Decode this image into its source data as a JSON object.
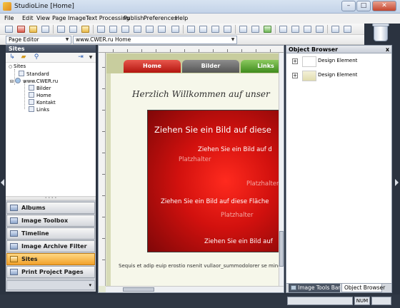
{
  "window": {
    "title": "StudioLine [Home]",
    "minimize": "–",
    "maximize": "□",
    "close": "✕"
  },
  "menu": [
    "File",
    "Edit",
    "View",
    "Page",
    "Image",
    "Text Processing",
    "Publish",
    "Preferences",
    "Help"
  ],
  "toolbar": {
    "mode_select": "Page Editor",
    "page_select": "www.CWER.ru  Home"
  },
  "sites_panel": {
    "title": "Sites",
    "tree": [
      "Sites",
      "Standard",
      "www.CWER.ru",
      "Bilder",
      "Home",
      "Kontakt",
      "Links"
    ]
  },
  "nav": {
    "items": [
      "Albums",
      "Image Toolbox",
      "Timeline",
      "Image Archive Filter",
      "Sites",
      "Print Project Pages"
    ],
    "active": "Sites"
  },
  "editor": {
    "tabs": [
      "Home",
      "Bilder",
      "Links"
    ],
    "headline": "Herzlich Willkommen auf unser",
    "hero_lines": [
      "Ziehen Sie ein Bild auf diese",
      "Ziehen Sie ein Bild auf d",
      "Platzhalter",
      "Platzhalter",
      "Ziehen Sie ein Bild auf diese Fläche",
      "Platzhalter",
      "Ziehen Sie ein Bild auf"
    ],
    "footer": "Sequis et adip euip erostio nsenit vullaor_summodolorer se mincil"
  },
  "object_browser": {
    "title": "Object Browser",
    "close": "x",
    "items": [
      "Design Element",
      "Design Element"
    ],
    "tabs": [
      "Image Tools Bar",
      "Object Browser"
    ]
  },
  "status": {
    "num": "NUM"
  },
  "colors": {
    "accent_red": "#d2110e",
    "active_nav": "#f2a12a"
  }
}
